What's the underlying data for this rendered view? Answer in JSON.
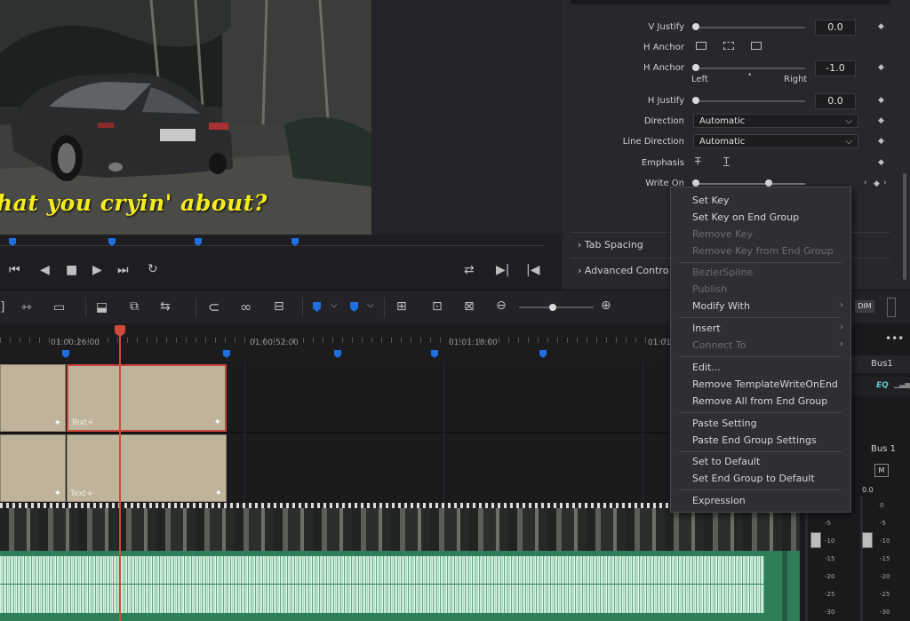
{
  "viewer": {
    "overlay_text": "hat you cryin' about?"
  },
  "inspector": {
    "v_justify": {
      "label": "V Justify",
      "value": "0.0"
    },
    "h_anchor": {
      "label": "H Anchor"
    },
    "h_anchor_slider": {
      "label": "H Anchor",
      "value": "-1.0",
      "left": "Left",
      "right": "Right"
    },
    "h_justify": {
      "label": "H Justify",
      "value": "0.0"
    },
    "direction": {
      "label": "Direction",
      "value": "Automatic"
    },
    "line_direction": {
      "label": "Line Direction",
      "value": "Automatic"
    },
    "emphasis": {
      "label": "Emphasis"
    },
    "write_on": {
      "label": "Write On"
    },
    "tab_spacing": "Tab Spacing",
    "advanced_controls": "Advanced Contro"
  },
  "timeline": {
    "timecodes": [
      "01:00:26:00",
      "01:00:52:00",
      "01:01:18:00",
      "01:01"
    ],
    "clip_label": "Text+"
  },
  "mixer": {
    "bus_header": "Bus1",
    "eq": "EQ",
    "bus_label": "Bus 1",
    "mute": "M",
    "level": "0.0",
    "dim": "DIM",
    "scale": [
      "0",
      "-5",
      "-10",
      "-15",
      "-20",
      "-25",
      "-30"
    ]
  },
  "context_menu": {
    "items": [
      {
        "label": "Set Key",
        "enabled": true
      },
      {
        "label": "Set Key on End Group",
        "enabled": true
      },
      {
        "label": "Remove Key",
        "enabled": false
      },
      {
        "label": "Remove Key from End Group",
        "enabled": false
      },
      {
        "label": "BezierSpline",
        "enabled": false
      },
      {
        "label": "Publish",
        "enabled": false
      },
      {
        "label": "Modify With",
        "enabled": true,
        "submenu": true
      },
      {
        "label": "Insert",
        "enabled": true,
        "submenu": true
      },
      {
        "label": "Connect To",
        "enabled": false,
        "submenu": true
      },
      {
        "label": "Edit...",
        "enabled": true
      },
      {
        "label": "Remove TemplateWriteOnEnd",
        "enabled": true
      },
      {
        "label": "Remove All from End Group",
        "enabled": true
      },
      {
        "label": "Paste Setting",
        "enabled": true
      },
      {
        "label": "Paste End Group Settings",
        "enabled": true
      },
      {
        "label": "Set to Default",
        "enabled": true
      },
      {
        "label": "Set End Group to Default",
        "enabled": true
      },
      {
        "label": "Expression",
        "enabled": true
      }
    ]
  },
  "colors": {
    "accent": "#1e6fe0",
    "playhead": "#d24a3b",
    "caption": "#f4ec1c",
    "audio": "#2e7e58",
    "clip": "#bfb49b"
  }
}
